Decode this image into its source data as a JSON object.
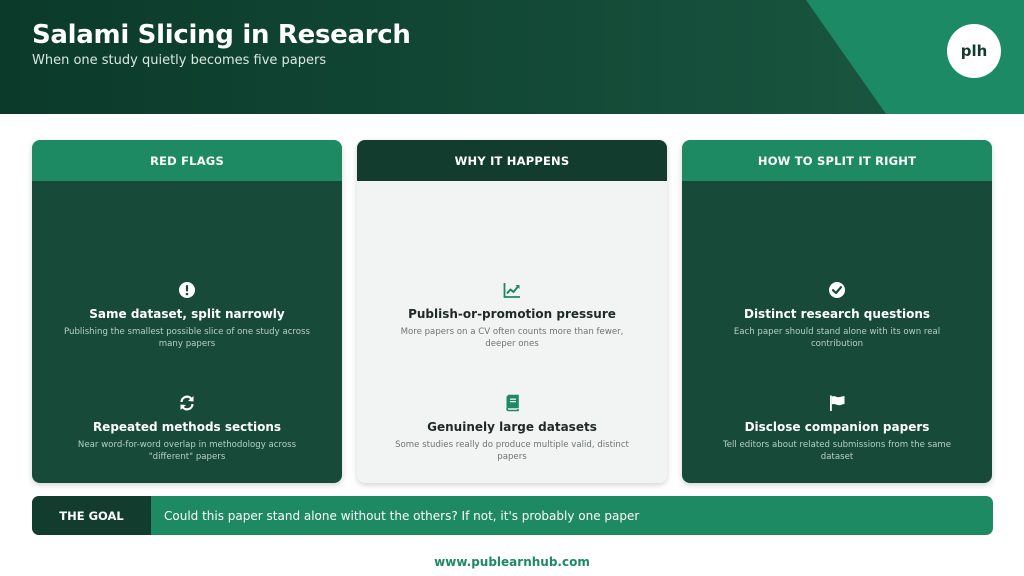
{
  "header": {
    "title": "Salami Slicing in Research",
    "subtitle": "When one study quietly becomes five papers",
    "logo_text": "plh"
  },
  "columns": [
    {
      "heading": "RED FLAGS",
      "theme": "dark",
      "items": [
        {
          "icon": "exclamation-circle-icon",
          "title": "Same dataset, split narrowly",
          "text": "Publishing the smallest possible slice of one study across many papers"
        },
        {
          "icon": "refresh-icon",
          "title": "Repeated methods sections",
          "text": "Near word-for-word overlap in methodology across \"different\" papers"
        }
      ]
    },
    {
      "heading": "WHY IT HAPPENS",
      "theme": "light",
      "items": [
        {
          "icon": "line-chart-icon",
          "title": "Publish-or-promotion pressure",
          "text": "More papers on a CV often counts more than fewer, deeper ones"
        },
        {
          "icon": "book-icon",
          "title": "Genuinely large datasets",
          "text": "Some studies really do produce multiple valid, distinct papers"
        }
      ]
    },
    {
      "heading": "HOW TO SPLIT IT RIGHT",
      "theme": "dark",
      "items": [
        {
          "icon": "check-circle-icon",
          "title": "Distinct research questions",
          "text": "Each paper should stand alone with its own real contribution"
        },
        {
          "icon": "flag-icon",
          "title": "Disclose companion papers",
          "text": "Tell editors about related submissions from the same dataset"
        }
      ]
    }
  ],
  "goal": {
    "label": "THE GOAL",
    "text": "Could this paper stand alone without the others? If not, it's probably one paper"
  },
  "footer": {
    "url": "www.publearnhub.com"
  },
  "colors": {
    "dark_green": "#123d2e",
    "accent_green": "#1d8a63",
    "card_dark": "#174a38",
    "card_light": "#f2f3f3"
  }
}
